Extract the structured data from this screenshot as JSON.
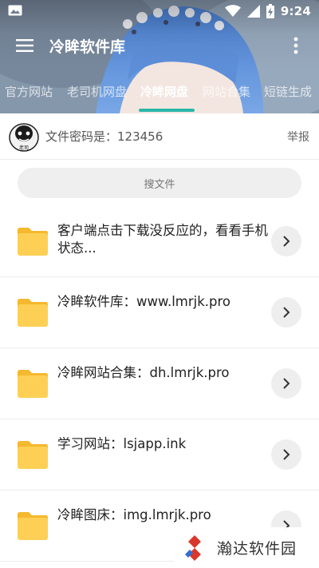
{
  "status_bar": {
    "time": "9:24",
    "icons": [
      "image-icon",
      "wifi-icon",
      "signal-icon",
      "battery-charging-icon"
    ]
  },
  "app_bar": {
    "title": "冷眸软件库",
    "icons": [
      "menu-icon",
      "more-vertical-icon"
    ]
  },
  "tabs": [
    {
      "label": "官方网站"
    },
    {
      "label": "老司机网盘"
    },
    {
      "label": "冷眸网盘",
      "active": true
    },
    {
      "label": "网站合集"
    },
    {
      "label": "短链生成"
    }
  ],
  "info": {
    "password_text": "文件密码是：123456",
    "report_label": "举报",
    "avatar_caption": "老司"
  },
  "search": {
    "label": "搜文件"
  },
  "files": [
    {
      "text": "客户端点击下载没反应的，看看手机状态..."
    },
    {
      "text": "冷眸软件库：www.lmrjk.pro"
    },
    {
      "text": "冷眸网站合集：dh.lmrjk.pro"
    },
    {
      "text": "学习网站：lsjapp.ink"
    },
    {
      "text": "冷眸图床：img.lmrjk.pro"
    }
  ],
  "watermark": {
    "text": "瀚达软件园"
  },
  "colors": {
    "accent": "#2ab7a9",
    "folder": "#fdd055",
    "folder_tab": "#f5b82e",
    "watermark_logo": "#d9362c"
  }
}
